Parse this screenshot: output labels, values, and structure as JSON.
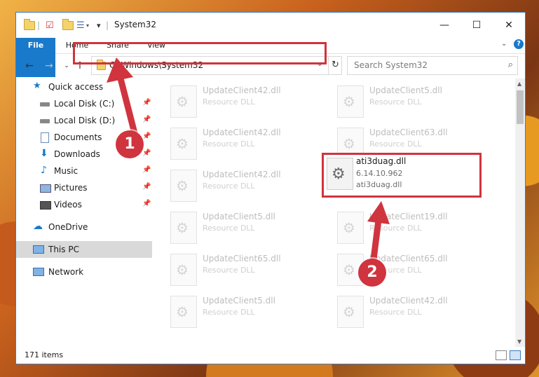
{
  "window": {
    "title": "System32",
    "controls": {
      "minimize": "—",
      "maximize": "☐",
      "close": "✕"
    }
  },
  "ribbon": {
    "tabs": [
      "File",
      "Home",
      "Share",
      "View"
    ],
    "help": "?"
  },
  "navbar": {
    "address": "C:\\Windows\\System32",
    "search_placeholder": "Search System32"
  },
  "sidebar": {
    "items": [
      {
        "label": "Quick access",
        "icon": "star-icon",
        "pinned": false
      },
      {
        "label": "Local Disk (C:)",
        "icon": "drive-icon",
        "pinned": true
      },
      {
        "label": "Local Disk (D:)",
        "icon": "drive-icon",
        "pinned": true
      },
      {
        "label": "Documents",
        "icon": "documents-icon",
        "pinned": true
      },
      {
        "label": "Downloads",
        "icon": "download-icon",
        "pinned": true
      },
      {
        "label": "Music",
        "icon": "music-icon",
        "pinned": true
      },
      {
        "label": "Pictures",
        "icon": "pictures-icon",
        "pinned": true
      },
      {
        "label": "Videos",
        "icon": "videos-icon",
        "pinned": true
      },
      {
        "label": "OneDrive",
        "icon": "cloud-icon",
        "pinned": false
      },
      {
        "label": "This PC",
        "icon": "computer-icon",
        "pinned": false,
        "selected": true
      },
      {
        "label": "Network",
        "icon": "network-icon",
        "pinned": false
      }
    ]
  },
  "files": {
    "left": [
      {
        "name": "UpdateClient42.dll",
        "type": "Resource DLL"
      },
      {
        "name": "UpdateClient42.dll",
        "type": "Resource DLL"
      },
      {
        "name": "UpdateClient42.dll",
        "type": "Resource DLL"
      },
      {
        "name": "UpdateClient5.dll",
        "type": "Resource DLL"
      },
      {
        "name": "UpdateClient65.dll",
        "type": "Resource DLL"
      },
      {
        "name": "UpdateClient5.dll",
        "type": "Resource DLL"
      }
    ],
    "right": [
      {
        "name": "UpdateClient5.dll",
        "type": "Resource DLL"
      },
      {
        "name": "UpdateClient63.dll",
        "type": "Resource DLL"
      },
      {
        "name": "",
        "type": ""
      },
      {
        "name": "UpdateClient19.dll",
        "type": "Resource DLL"
      },
      {
        "name": "UpdateClient65.dll",
        "type": "Resource DLL"
      },
      {
        "name": "UpdateClient42.dll",
        "type": "Resource DLL"
      }
    ],
    "highlighted": {
      "name": "ati3duag.dll",
      "version": "6.14.10.962",
      "description": "ati3duag.dll"
    }
  },
  "status": {
    "item_count": "171 items"
  },
  "annotations": {
    "step1": "1",
    "step2": "2",
    "color": "#d0343e"
  }
}
